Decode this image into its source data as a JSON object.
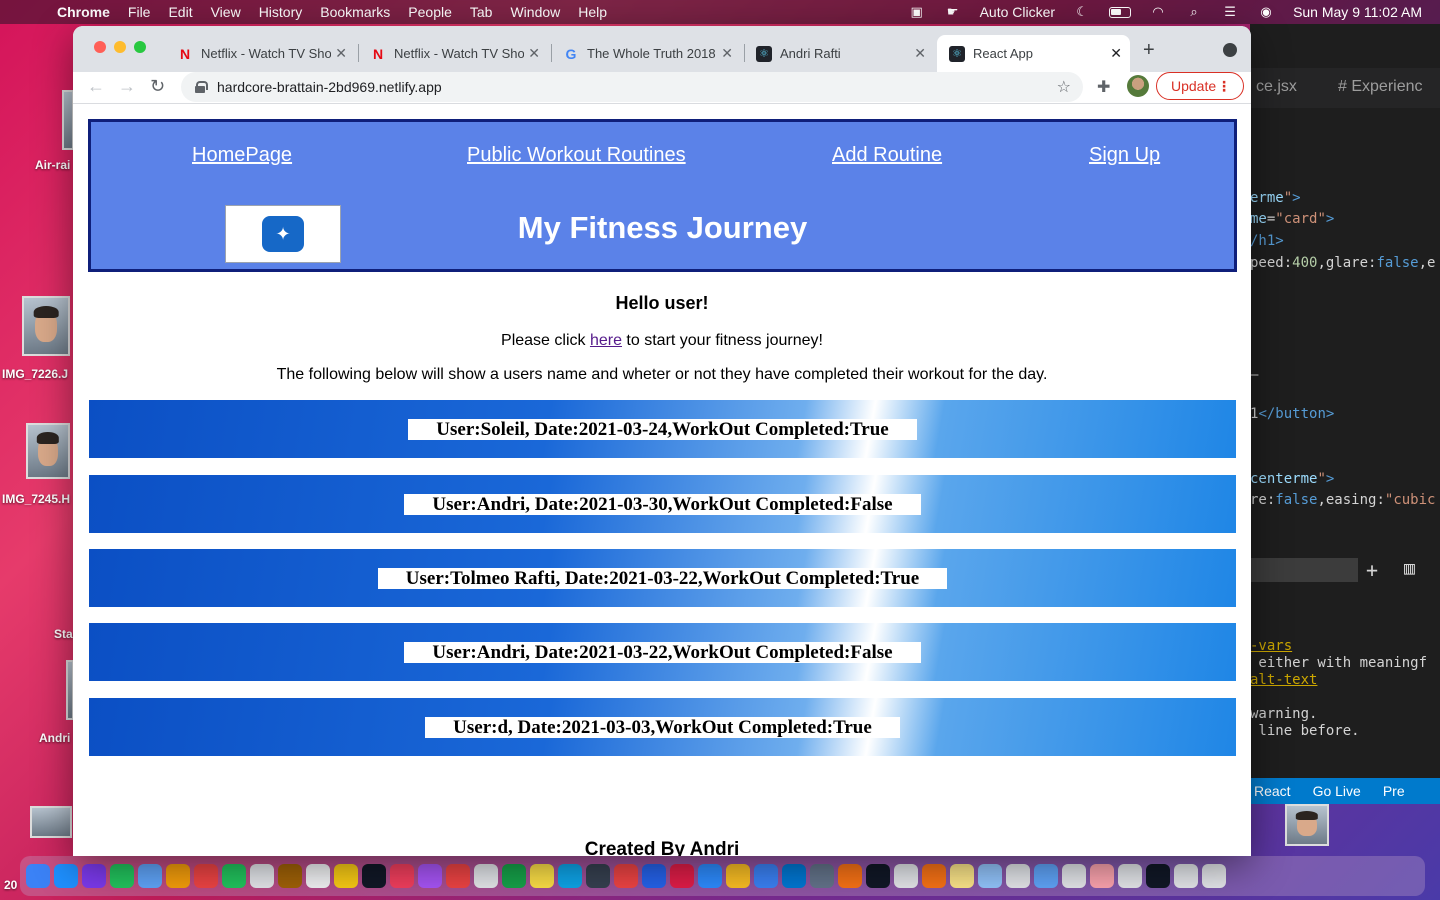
{
  "menubar": {
    "app": "Chrome",
    "items": [
      "File",
      "Edit",
      "View",
      "History",
      "Bookmarks",
      "People",
      "Tab",
      "Window",
      "Help"
    ],
    "status_app": "Auto Clicker",
    "clock": "Sun May 9  11:02 AM"
  },
  "desktop": {
    "items": [
      "Air-rai",
      "IMG_7226.J",
      "IMG_7245.H",
      "Sta",
      "Andri",
      "20"
    ]
  },
  "editor": {
    "tabs": [
      "ce.jsx",
      "# Experienc"
    ],
    "status": [
      "React",
      "Go Live",
      "Pre"
    ]
  },
  "browser": {
    "tabs": [
      {
        "title": "Netflix - Watch TV Sho",
        "icon": "netflix-icon"
      },
      {
        "title": "Netflix - Watch TV Sho",
        "icon": "netflix-icon"
      },
      {
        "title": "The Whole Truth 2018",
        "icon": "google-icon"
      },
      {
        "title": "Andri Rafti",
        "icon": "react-icon"
      },
      {
        "title": "React App",
        "icon": "react-icon"
      }
    ],
    "url": "hardcore-brattain-2bd969.netlify.app",
    "update_label": "Update"
  },
  "page": {
    "nav": [
      "HomePage",
      "Public Workout Routines",
      "Add Routine",
      "Sign Up"
    ],
    "title": "My Fitness Journey",
    "greeting": "Hello user!",
    "cta_before": "Please click ",
    "cta_link": "here",
    "cta_after": " to start your fitness journey!",
    "description": "The following below will show a users name and wheter or not they have completed their workout for the day.",
    "entries": [
      "User:Soleil, Date:2021-03-24,WorkOut Completed:True",
      "User:Andri, Date:2021-03-30,WorkOut Completed:False",
      "User:Tolmeo Rafti, Date:2021-03-22,WorkOut Completed:True",
      "User:Andri, Date:2021-03-22,WorkOut Completed:False",
      "User:d, Date:2021-03-03,WorkOut Completed:True"
    ],
    "footer": "Created By Andri"
  },
  "colors": {
    "header_bg": "#5b82e8",
    "header_border": "#0f1f7a",
    "update_red": "#d93025"
  }
}
